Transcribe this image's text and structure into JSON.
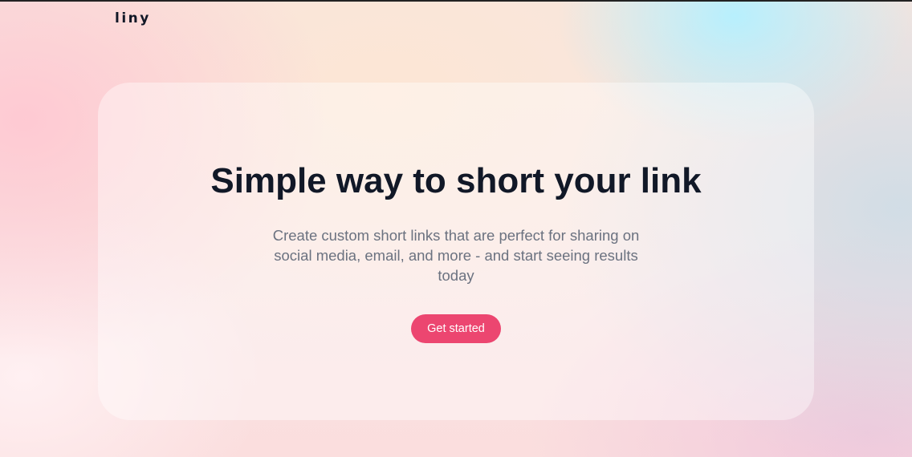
{
  "header": {
    "logo": "liny"
  },
  "hero": {
    "title": "Simple way to short your link",
    "subtitle": "Create custom short links that are perfect for sharing on social media, email, and more - and start seeing results today",
    "cta_label": "Get started"
  },
  "colors": {
    "accent": "#ec4670",
    "heading": "#111827",
    "body_text": "#6b7280"
  }
}
